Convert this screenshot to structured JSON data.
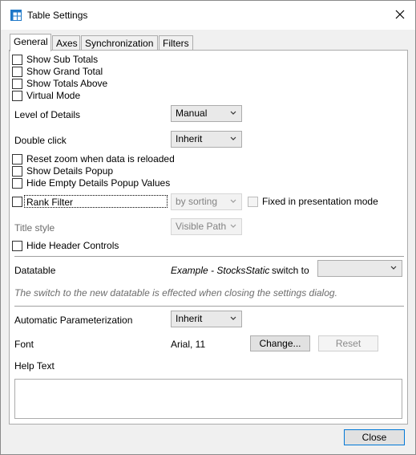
{
  "window": {
    "title": "Table Settings",
    "icon": "table-settings-icon",
    "close_icon": "close-icon"
  },
  "tabs": [
    {
      "label": "General",
      "active": true
    },
    {
      "label": "Axes"
    },
    {
      "label": "Synchronization"
    },
    {
      "label": "Filters"
    }
  ],
  "general": {
    "checkboxes_top": [
      {
        "label": "Show Sub Totals",
        "checked": false
      },
      {
        "label": "Show Grand Total",
        "checked": false
      },
      {
        "label": "Show Totals Above",
        "checked": false
      },
      {
        "label": "Virtual Mode",
        "checked": false
      }
    ],
    "level_of_details": {
      "label": "Level of Details",
      "value": "Manual"
    },
    "double_click": {
      "label": "Double click",
      "value": "Inherit"
    },
    "checkboxes_mid": [
      {
        "label": "Reset zoom when data is reloaded",
        "checked": false
      },
      {
        "label": "Show Details Popup",
        "checked": false
      },
      {
        "label": "Hide Empty Details Popup Values",
        "checked": false
      }
    ],
    "rank_filter": {
      "label": "Rank Filter",
      "checked": false,
      "value": "by sorting"
    },
    "fixed_presentation": {
      "label": "Fixed in presentation mode",
      "checked": false
    },
    "title_style": {
      "label": "Title style",
      "value": "Visible Path"
    },
    "hide_header_controls": {
      "label": "Hide Header Controls",
      "checked": false
    },
    "datatable": {
      "label": "Datatable",
      "name": "Example - StocksStatic",
      "switch_to_label": "switch to",
      "switch_value": "",
      "note": "The switch to the new datatable is effected when closing the settings dialog."
    },
    "auto_param": {
      "label": "Automatic Parameterization",
      "value": "Inherit"
    },
    "font": {
      "label": "Font",
      "value": "Arial, 11",
      "change_label": "Change...",
      "reset_label": "Reset"
    },
    "help_text": {
      "label": "Help Text",
      "value": ""
    }
  },
  "footer": {
    "close_label": "Close"
  }
}
